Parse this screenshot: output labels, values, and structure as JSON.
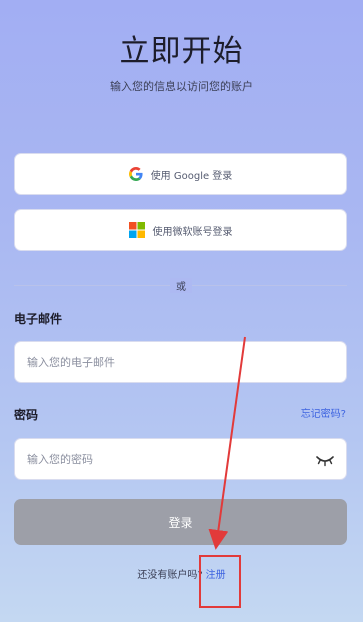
{
  "page": {
    "title": "立即开始",
    "subtitle": "输入您的信息以访问您的账户"
  },
  "social": {
    "google_label": "使用 Google 登录",
    "microsoft_label": "使用微软账号登录"
  },
  "divider": {
    "text": "或"
  },
  "email": {
    "label": "电子邮件",
    "placeholder": "输入您的电子邮件",
    "value": ""
  },
  "password": {
    "label": "密码",
    "forgot_label": "忘记密码?",
    "placeholder": "输入您的密码",
    "value": ""
  },
  "login": {
    "label": "登录"
  },
  "signup": {
    "prompt": "还没有账户吗?",
    "link": "注册"
  },
  "colors": {
    "accent": "#3d63e0",
    "login_button": "#9d9fa8",
    "annotation": "#e23a3a"
  }
}
